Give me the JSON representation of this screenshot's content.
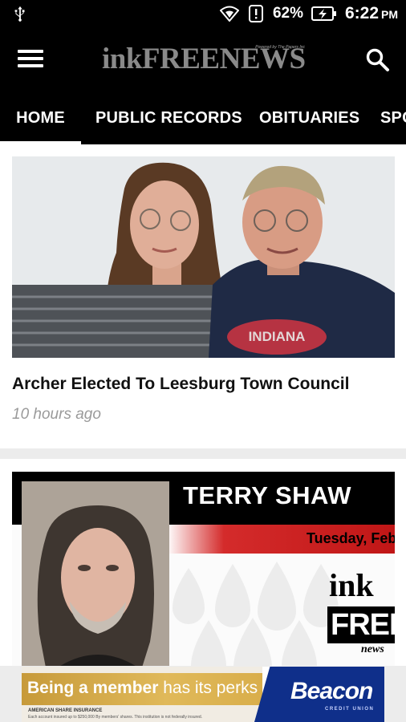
{
  "status_bar": {
    "battery_percent": "62%",
    "time": "6:22",
    "ampm": "PM",
    "icons": [
      "usb-icon",
      "wifi-icon",
      "alert-icon",
      "battery-charging-icon"
    ]
  },
  "app_bar": {
    "logo": "inkFREENEWS",
    "logo_tag": "Powered by The Papers Inc",
    "icons": [
      "menu-icon",
      "search-icon"
    ]
  },
  "tabs": [
    {
      "label": "HOME",
      "active": true
    },
    {
      "label": "PUBLIC RECORDS",
      "active": false
    },
    {
      "label": "OBITUARIES",
      "active": false
    },
    {
      "label": "SPO",
      "active": false
    }
  ],
  "articles": [
    {
      "headline": "Archer Elected To Leesburg Town Council",
      "time": "10 hours ago",
      "shirt_text": "INDIANA"
    },
    {
      "name_banner": "TERRY SHAW",
      "date_banner": "Tuesday, Feb.",
      "brand_ink": "ink",
      "brand_free": "FREE",
      "brand_news": "news"
    }
  ],
  "ad": {
    "text_bold": "Being a member",
    "text_rest": " has its perks",
    "fine_print_1": "AMERICAN SHARE INSURANCE",
    "fine_print_2": "Each account insured up to $250,000    By members' shares. This institution is not federally insured.",
    "brand": "Beacon",
    "brand_sub": "CREDIT UNION"
  },
  "colors": {
    "bar_bg": "#000000",
    "feed_bg": "#ececec",
    "banner_red": "#c01616",
    "ad_gold": "#d9ae4b",
    "ad_blue": "#0f2f8a"
  }
}
